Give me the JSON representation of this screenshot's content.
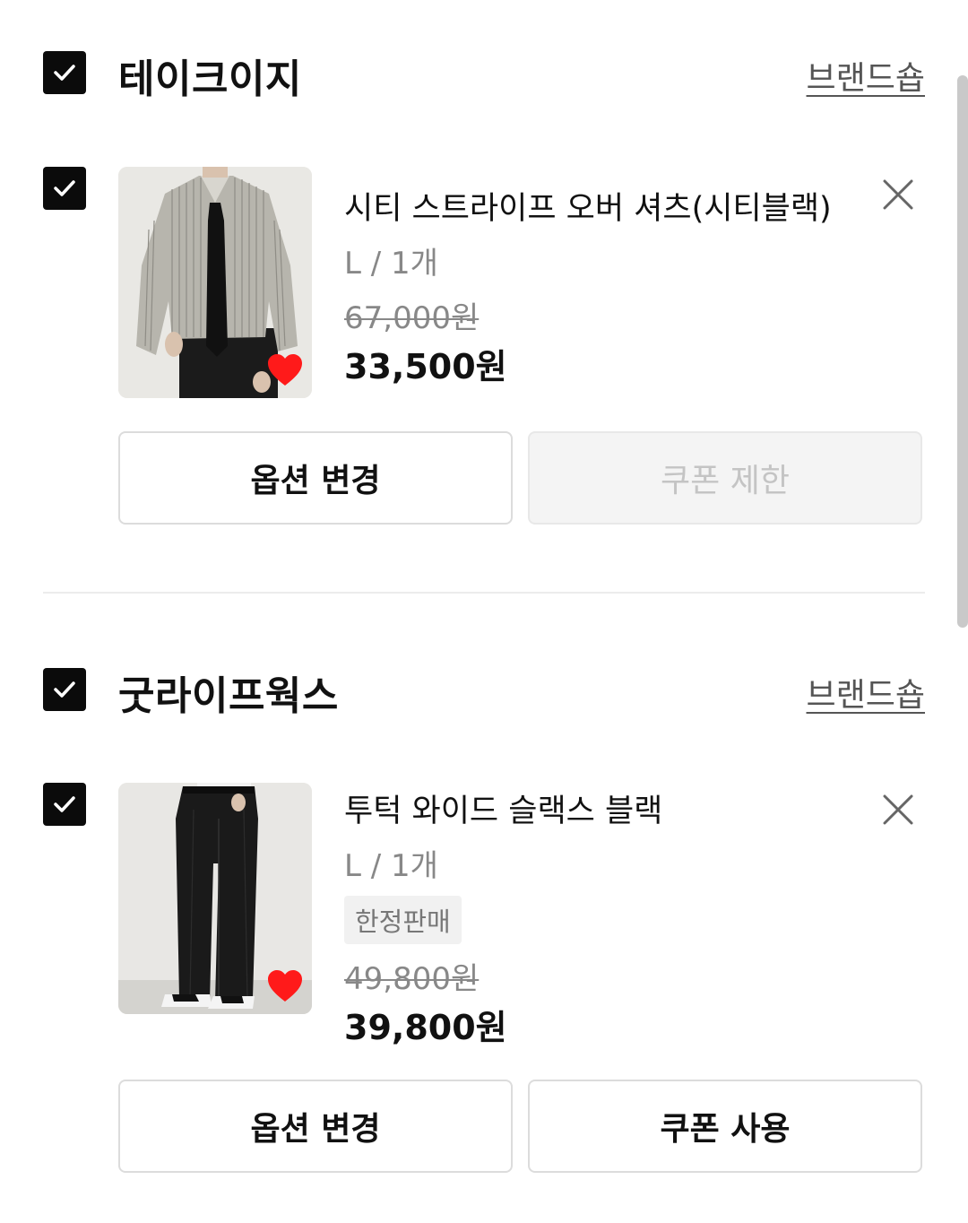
{
  "groups": [
    {
      "brand": "테이크이지",
      "brand_link": "브랜드숍",
      "item": {
        "title": "시티 스트라이프 오버 셔츠(시티블랙)",
        "option": "L / 1개",
        "original_price": "67,000원",
        "price": "33,500원",
        "badge": "",
        "buttons": {
          "option_change": "옵션 변경",
          "coupon": "쿠폰 제한"
        }
      }
    },
    {
      "brand": "굿라이프웍스",
      "brand_link": "브랜드숍",
      "item": {
        "title": "투턱 와이드 슬랙스 블랙",
        "option": "L / 1개",
        "original_price": "49,800원",
        "price": "39,800원",
        "badge": "한정판매",
        "buttons": {
          "option_change": "옵션 변경",
          "coupon": "쿠폰 사용"
        }
      }
    }
  ],
  "icons": {
    "checkbox": "checkbox-checked-icon",
    "close": "close-icon",
    "heart": "heart-icon"
  },
  "colors": {
    "checkbox": "#0b0b0b",
    "heart": "#ff1a1a",
    "muted": "#888888",
    "disabled_bg": "#f4f4f4"
  }
}
